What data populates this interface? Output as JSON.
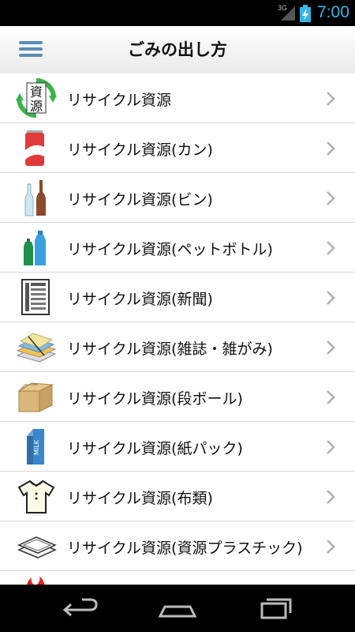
{
  "status_bar": {
    "network": "3G",
    "time": "7:00"
  },
  "app_bar": {
    "title": "ごみの出し方"
  },
  "icon_text": {
    "recycle_top": "資",
    "recycle_bottom": "源",
    "milk": "MILK"
  },
  "items": [
    {
      "label": "リサイクル資源",
      "icon": "recycle-resource-icon"
    },
    {
      "label": "リサイクル資源(カン)",
      "icon": "can-icon"
    },
    {
      "label": "リサイクル資源(ビン)",
      "icon": "bottle-icon"
    },
    {
      "label": "リサイクル資源(ペットボトル)",
      "icon": "pet-bottle-icon"
    },
    {
      "label": "リサイクル資源(新聞)",
      "icon": "newspaper-icon"
    },
    {
      "label": "リサイクル資源(雑誌・雑がみ)",
      "icon": "magazine-icon"
    },
    {
      "label": "リサイクル資源(段ボール)",
      "icon": "cardboard-icon"
    },
    {
      "label": "リサイクル資源(紙パック)",
      "icon": "milk-carton-icon"
    },
    {
      "label": "リサイクル資源(布類)",
      "icon": "clothing-icon"
    },
    {
      "label": "リサイクル資源(資源プラスチック)",
      "icon": "plastic-tray-icon"
    }
  ],
  "colors": {
    "accent": "#33b5e5",
    "menu": "#5b8db8",
    "chevron": "#b0b0b0"
  }
}
